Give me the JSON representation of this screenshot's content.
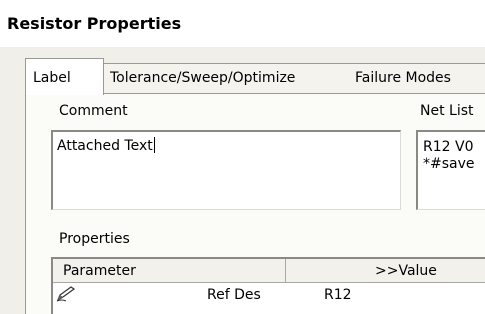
{
  "window": {
    "title": "Resistor Properties"
  },
  "tabs": [
    {
      "label": "Label",
      "active": true
    },
    {
      "label": "Tolerance/Sweep/Optimize",
      "active": false
    },
    {
      "label": "Failure Modes",
      "active": false
    }
  ],
  "label_tab": {
    "comment": {
      "label": "Comment",
      "value": "Attached Text"
    },
    "netlist": {
      "label": "Net List",
      "lines": [
        "R12 V0",
        "*#save"
      ]
    },
    "properties": {
      "label": "Properties",
      "columns": [
        "Parameter",
        ">>Value"
      ],
      "rows": [
        {
          "icon": "pencil-icon",
          "parameter": "Ref Des",
          "value": "R12"
        }
      ]
    }
  }
}
